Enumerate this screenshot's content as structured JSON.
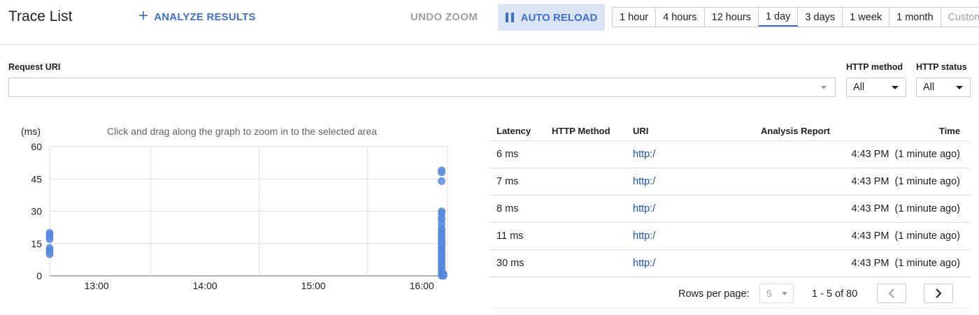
{
  "header": {
    "title": "Trace List",
    "analyze_label": "ANALYZE RESULTS",
    "undo_zoom_label": "UNDO ZOOM",
    "auto_reload_label": "AUTO RELOAD",
    "time_ranges": [
      "1 hour",
      "4 hours",
      "12 hours",
      "1 day",
      "3 days",
      "1 week",
      "1 month",
      "Custom"
    ],
    "selected_range": "1 day",
    "accent_color": "#3f6fd0"
  },
  "filters": {
    "request_uri_label": "Request URI",
    "request_uri_value": "",
    "http_method_label": "HTTP method",
    "http_method_value": "All",
    "http_status_label": "HTTP status",
    "http_status_value": "All"
  },
  "chart_hint": "Click and drag along the graph to zoom in to the selected area",
  "chart_data": {
    "type": "scatter",
    "ylabel": "(ms)",
    "ylim": [
      0,
      60
    ],
    "yticks": [
      "0",
      "15",
      "30",
      "45",
      "60"
    ],
    "xticks": [
      "13:00",
      "14:00",
      "15:00",
      "16:00"
    ],
    "series": [
      {
        "points": [
          {
            "x": "12:34",
            "y": 20
          },
          {
            "x": "12:34",
            "y": 19
          },
          {
            "x": "12:34",
            "y": 18
          },
          {
            "x": "12:34",
            "y": 17
          },
          {
            "x": "12:34",
            "y": 13
          },
          {
            "x": "12:34",
            "y": 12
          },
          {
            "x": "12:34",
            "y": 11
          },
          {
            "x": "12:34",
            "y": 10
          },
          {
            "x": "16:11",
            "y": 49
          },
          {
            "x": "16:11",
            "y": 48
          },
          {
            "x": "16:11",
            "y": 44
          },
          {
            "x": "16:11",
            "y": 30
          },
          {
            "x": "16:11",
            "y": 29
          },
          {
            "x": "16:11",
            "y": 27
          },
          {
            "x": "16:11",
            "y": 26
          },
          {
            "x": "16:11",
            "y": 24
          },
          {
            "x": "16:11",
            "y": 22
          },
          {
            "x": "16:11",
            "y": 21
          },
          {
            "x": "16:11",
            "y": 20
          },
          {
            "x": "16:11",
            "y": 19
          },
          {
            "x": "16:11",
            "y": 18
          },
          {
            "x": "16:11",
            "y": 17
          },
          {
            "x": "16:11",
            "y": 16
          },
          {
            "x": "16:11",
            "y": 15
          },
          {
            "x": "16:11",
            "y": 14
          },
          {
            "x": "16:11",
            "y": 13
          },
          {
            "x": "16:11",
            "y": 12
          },
          {
            "x": "16:11",
            "y": 11
          },
          {
            "x": "16:11",
            "y": 10
          },
          {
            "x": "16:11",
            "y": 9
          },
          {
            "x": "16:11",
            "y": 8
          },
          {
            "x": "16:11",
            "y": 7
          },
          {
            "x": "16:11",
            "y": 6
          },
          {
            "x": "16:11",
            "y": 5
          },
          {
            "x": "16:11",
            "y": 4
          },
          {
            "x": "16:11",
            "y": 3
          },
          {
            "x": "16:11",
            "y": 2
          },
          {
            "x": "16:11",
            "y": 1
          },
          {
            "x": "16:11",
            "y": 0
          },
          {
            "x": "16:12",
            "y": 0
          },
          {
            "x": "16:12",
            "y": 1
          },
          {
            "x": "16:12",
            "y": 0
          }
        ]
      }
    ],
    "color": "#5b8de0",
    "grid": true
  },
  "table": {
    "columns": [
      "Latency",
      "HTTP Method",
      "URI",
      "Analysis Report",
      "Time"
    ],
    "rows": [
      {
        "latency": "6 ms",
        "method": "",
        "uri": "http:/",
        "report": "",
        "time": "4:43 PM  (1 minute ago)"
      },
      {
        "latency": "7 ms",
        "method": "",
        "uri": "http:/",
        "report": "",
        "time": "4:43 PM  (1 minute ago)"
      },
      {
        "latency": "8 ms",
        "method": "",
        "uri": "http:/",
        "report": "",
        "time": "4:43 PM  (1 minute ago)"
      },
      {
        "latency": "11 ms",
        "method": "",
        "uri": "http:/",
        "report": "",
        "time": "4:43 PM  (1 minute ago)"
      },
      {
        "latency": "30 ms",
        "method": "",
        "uri": "http:/",
        "report": "",
        "time": "4:43 PM  (1 minute ago)"
      }
    ]
  },
  "pagination": {
    "rows_per_page_label": "Rows per page:",
    "rows_per_page_value": "5",
    "range_text": "1 - 5 of 80"
  }
}
